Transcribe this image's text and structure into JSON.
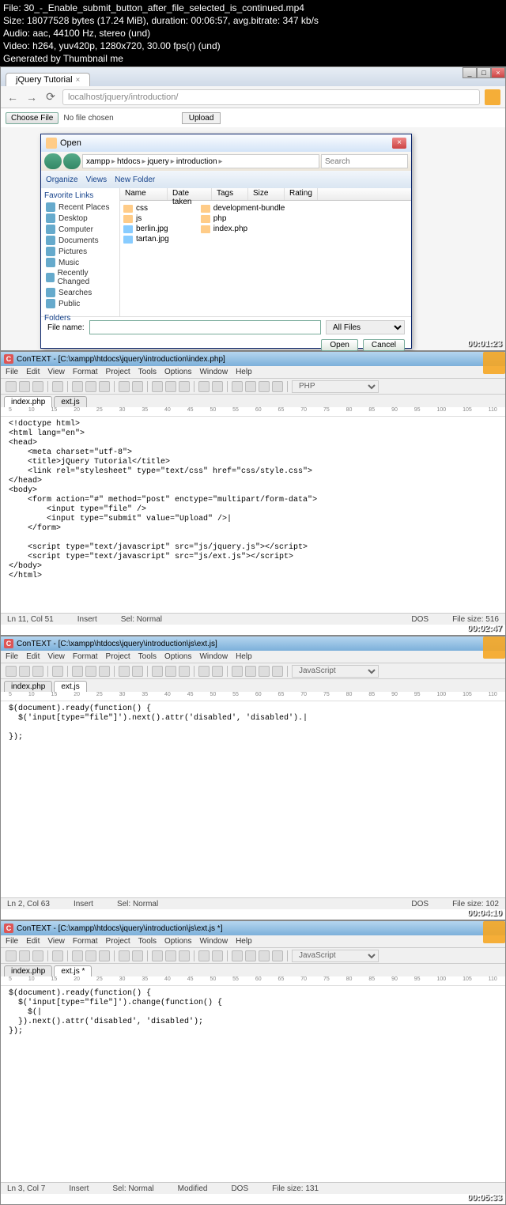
{
  "header": {
    "file_line": "File: 30_-_Enable_submit_button_after_file_selected_is_continued.mp4",
    "size_line": "Size: 18077528 bytes (17.24 MiB), duration: 00:06:57, avg.bitrate: 347 kb/s",
    "audio_line": "Audio: aac, 44100 Hz, stereo (und)",
    "video_line": "Video: h264, yuv420p, 1280x720, 30.00 fps(r) (und)",
    "gen_line": "Generated by Thumbnail me"
  },
  "browser": {
    "tab_title": "jQuery Tutorial",
    "url": "localhost/jquery/introduction/",
    "choose_label": "Choose File",
    "no_file": "No file chosen",
    "upload_label": "Upload",
    "timestamp": "00:01:23"
  },
  "file_dialog": {
    "title": "Open",
    "crumbs": [
      "xampp",
      "htdocs",
      "jquery",
      "introduction"
    ],
    "search_placeholder": "Search",
    "toolbar": {
      "organize": "Organize",
      "views": "Views",
      "newfolder": "New Folder"
    },
    "sidebar_header": "Favorite Links",
    "sidebar": [
      "Recent Places",
      "Desktop",
      "Computer",
      "Documents",
      "Pictures",
      "Music",
      "Recently Changed",
      "Searches",
      "Public"
    ],
    "folders_label": "Folders",
    "cols": [
      "Name",
      "Date taken",
      "Tags",
      "Size",
      "Rating"
    ],
    "items_left": [
      "css",
      "js",
      "berlin.jpg",
      "tartan.jpg"
    ],
    "items_right": [
      "development-bundle",
      "php",
      "index.php"
    ],
    "filename_label": "File name:",
    "filetype": "All Files",
    "open_btn": "Open",
    "cancel_btn": "Cancel"
  },
  "editor1": {
    "title": "ConTEXT - [C:\\xampp\\htdocs\\jquery\\introduction\\index.php]",
    "menu": [
      "File",
      "Edit",
      "View",
      "Format",
      "Project",
      "Tools",
      "Options",
      "Window",
      "Help"
    ],
    "lang": "PHP",
    "tabs": [
      "index.php",
      "ext.js"
    ],
    "code": "<!doctype html>\n<html lang=\"en\">\n<head>\n    <meta charset=\"utf-8\">\n    <title>jQuery Tutorial</title>\n    <link rel=\"stylesheet\" type=\"text/css\" href=\"css/style.css\">\n</head>\n<body>\n    <form action=\"#\" method=\"post\" enctype=\"multipart/form-data\">\n        <input type=\"file\" />\n        <input type=\"submit\" value=\"Upload\" />|\n    </form>\n\n    <script type=\"text/javascript\" src=\"js/jquery.js\"></script>\n    <script type=\"text/javascript\" src=\"js/ext.js\"></script>\n</body>\n</html>",
    "status": {
      "pos": "Ln 11, Col 51",
      "insert": "Insert",
      "sel": "Sel: Normal",
      "dos": "DOS",
      "size": "File size: 516"
    },
    "timestamp": "00:02:47"
  },
  "editor2": {
    "title": "ConTEXT - [C:\\xampp\\htdocs\\jquery\\introduction\\js\\ext.js]",
    "lang": "JavaScript",
    "tabs": [
      "index.php",
      "ext.js"
    ],
    "code": "$(document).ready(function() {\n  $('input[type=\"file\"]').next().attr('disabled', 'disabled').|\n\n});",
    "status": {
      "pos": "Ln 2, Col 63",
      "insert": "Insert",
      "sel": "Sel: Normal",
      "dos": "DOS",
      "size": "File size: 102"
    },
    "timestamp": "00:04:10"
  },
  "editor3": {
    "title": "ConTEXT - [C:\\xampp\\htdocs\\jquery\\introduction\\js\\ext.js *]",
    "lang": "JavaScript",
    "tabs": [
      "index.php",
      "ext.js *"
    ],
    "code": "$(document).ready(function() {\n  $('input[type=\"file\"]').change(function() {\n    $(|\n  }).next().attr('disabled', 'disabled');\n});",
    "status": {
      "pos": "Ln 3, Col 7",
      "insert": "Insert",
      "sel": "Sel: Normal",
      "mod": "Modified",
      "dos": "DOS",
      "size": "File size: 131"
    },
    "timestamp": "00:05:33"
  },
  "ruler": [
    "5",
    "10",
    "15",
    "20",
    "25",
    "30",
    "35",
    "40",
    "45",
    "50",
    "55",
    "60",
    "65",
    "70",
    "75",
    "80",
    "85",
    "90",
    "95",
    "100",
    "105",
    "110"
  ]
}
